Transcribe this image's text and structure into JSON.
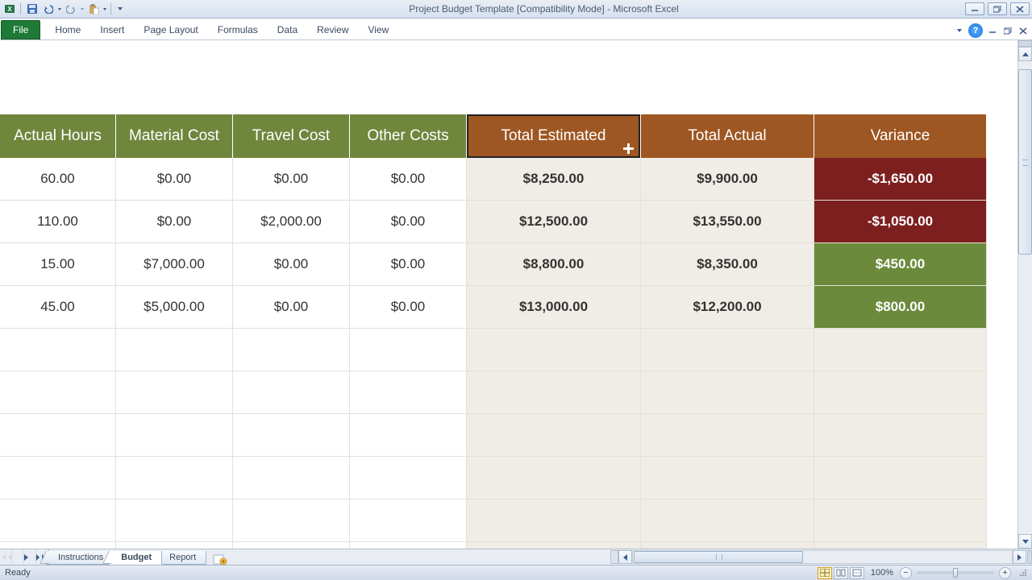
{
  "title": "Project Budget Template  [Compatibility Mode]  -  Microsoft Excel",
  "ribbon": {
    "file": "File",
    "tabs": [
      "Home",
      "Insert",
      "Page Layout",
      "Formulas",
      "Data",
      "Review",
      "View"
    ]
  },
  "headers": {
    "c1": "Actual Hours",
    "c2": "Material Cost",
    "c3": "Travel Cost",
    "c4": "Other Costs",
    "c5": "Total Estimated",
    "c6": "Total Actual",
    "c7": "Variance"
  },
  "rows": [
    {
      "c1": "60.00",
      "c2": "$0.00",
      "c3": "$0.00",
      "c4": "$0.00",
      "c5": "$8,250.00",
      "c6": "$9,900.00",
      "c7": "-$1,650.00",
      "varClass": "neg"
    },
    {
      "c1": "110.00",
      "c2": "$0.00",
      "c3": "$2,000.00",
      "c4": "$0.00",
      "c5": "$12,500.00",
      "c6": "$13,550.00",
      "c7": "-$1,050.00",
      "varClass": "neg"
    },
    {
      "c1": "15.00",
      "c2": "$7,000.00",
      "c3": "$0.00",
      "c4": "$0.00",
      "c5": "$8,800.00",
      "c6": "$8,350.00",
      "c7": "$450.00",
      "varClass": "pos"
    },
    {
      "c1": "45.00",
      "c2": "$5,000.00",
      "c3": "$0.00",
      "c4": "$0.00",
      "c5": "$13,000.00",
      "c6": "$12,200.00",
      "c7": "$800.00",
      "varClass": "pos"
    }
  ],
  "sheetTabs": {
    "t1": "Instructions",
    "t2": "Budget",
    "t3": "Report"
  },
  "status": {
    "ready": "Ready",
    "zoom": "100%"
  }
}
